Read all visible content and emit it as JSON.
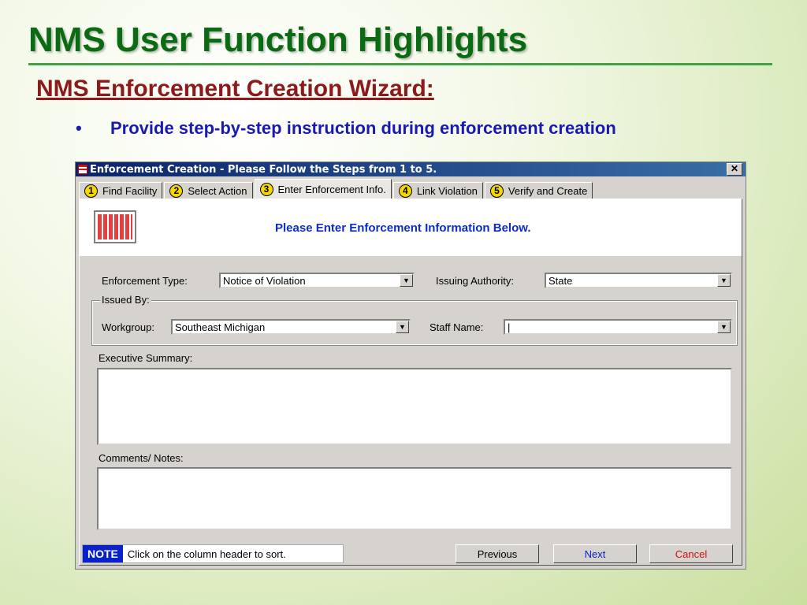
{
  "slide": {
    "title": "NMS User Function Highlights",
    "subtitle": "NMS Enforcement Creation Wizard:",
    "bullet_symbol": "•",
    "bullet": "Provide step-by-step instruction during enforcement creation"
  },
  "dialog": {
    "title": "Enforcement Creation - Please Follow the Steps from 1 to 5.",
    "close_symbol": "✕",
    "tabs": [
      {
        "num": "1",
        "label": "Find Facility"
      },
      {
        "num": "2",
        "label": "Select Action"
      },
      {
        "num": "3",
        "label": "Enter Enforcement Info.",
        "active": true
      },
      {
        "num": "4",
        "label": "Link Violation"
      },
      {
        "num": "5",
        "label": "Verify and Create"
      }
    ],
    "header_message": "Please Enter Enforcement Information Below.",
    "form": {
      "enforcement_type_label": "Enforcement Type:",
      "enforcement_type_value": "Notice of Violation",
      "issuing_authority_label": "Issuing Authority:",
      "issuing_authority_value": "State",
      "issued_by_legend": "Issued By:",
      "workgroup_label": "Workgroup:",
      "workgroup_value": "Southeast Michigan",
      "staff_name_label": "Staff Name:",
      "staff_name_value": "|",
      "executive_summary_label": "Executive Summary:",
      "comments_label": "Comments/ Notes:"
    },
    "footer": {
      "note_tag": "NOTE",
      "note_text": "Click on the column header to sort.",
      "previous_label": "Previous",
      "next_label": "Next",
      "cancel_label": "Cancel"
    },
    "drop_arrow": "▼"
  },
  "colors": {
    "slide_title": "#0b6b12",
    "subtitle": "#8b1a1a",
    "bullet": "#1a1ab0",
    "header_message": "#0b2cc5",
    "next_button_text": "#0a20c8",
    "cancel_button_text": "#d01010",
    "note_tag_bg": "#0a20c8"
  }
}
